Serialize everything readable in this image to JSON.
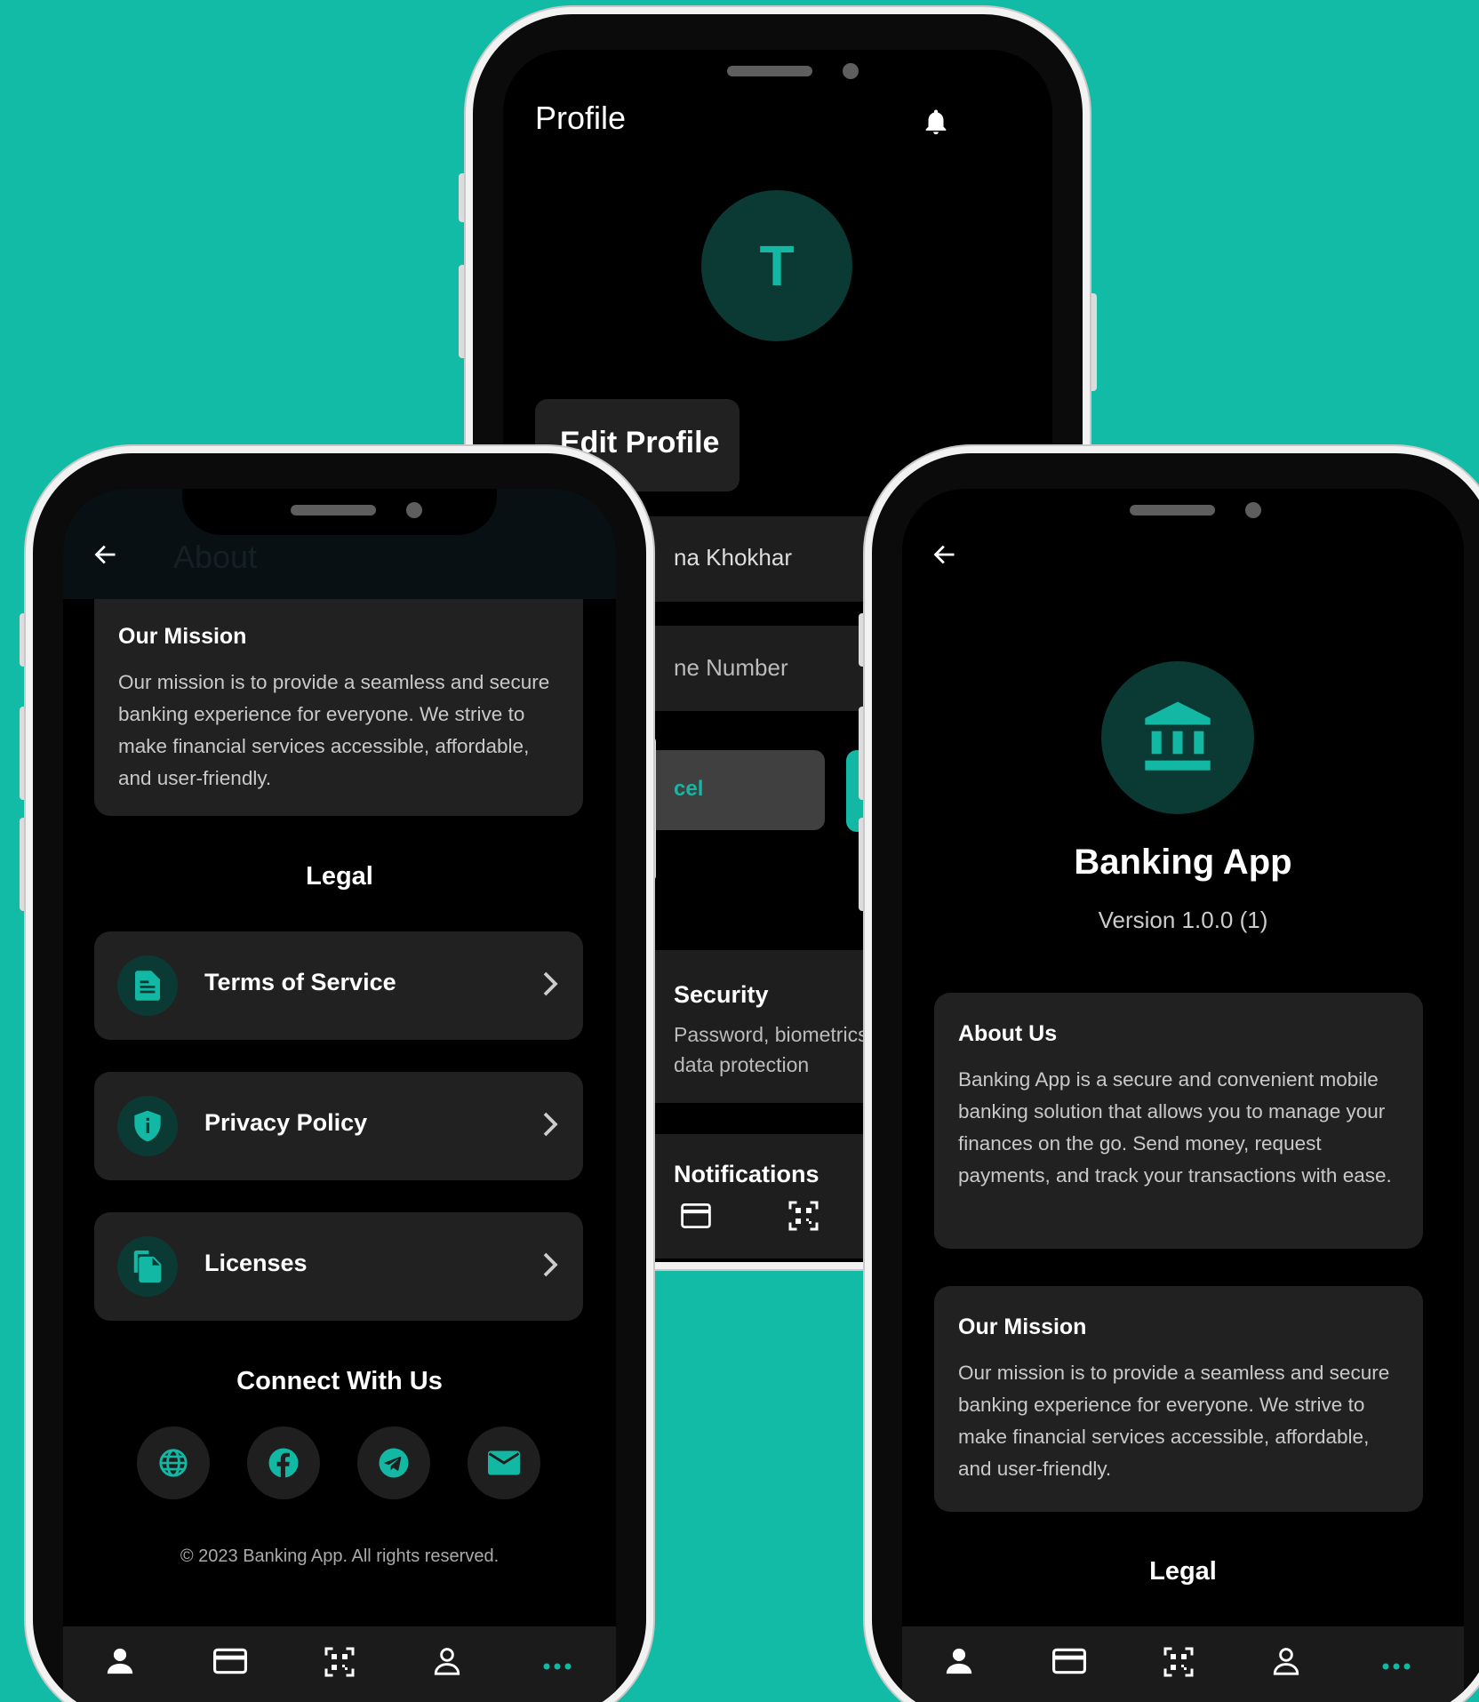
{
  "profile_phone": {
    "title": "Profile",
    "avatar_letter": "T",
    "edit_profile_label": "Edit Profile",
    "name_value": "na Khokhar",
    "phone_placeholder": "ne Number",
    "cancel_label": "cel",
    "security_title": "Security",
    "security_desc_1": "Password, biometrics,",
    "security_desc_2": "data protection",
    "notifications_title": "Notifications"
  },
  "about_left": {
    "header_title": "About",
    "mission": {
      "title": "Our Mission",
      "text": "Our mission is to provide a seamless and secure banking experience for everyone. We strive to make financial services accessible, affordable, and user-friendly."
    },
    "legal_heading": "Legal",
    "legal_items": [
      {
        "label": "Terms of Service",
        "icon": "document-icon"
      },
      {
        "label": "Privacy Policy",
        "icon": "shield-icon"
      },
      {
        "label": "Licenses",
        "icon": "copy-icon"
      }
    ],
    "connect_heading": "Connect With Us",
    "socials": [
      "globe-icon",
      "facebook-icon",
      "telegram-icon",
      "mail-icon"
    ],
    "copyright": "© 2023 Banking App. All rights reserved."
  },
  "about_right": {
    "app_name": "Banking App",
    "version": "Version 1.0.0 (1)",
    "about_us": {
      "title": "About Us",
      "text": "Banking App is a secure and convenient mobile banking solution that allows you to manage your finances on the go. Send money, request payments, and track your transactions with ease."
    },
    "mission": {
      "title": "Our Mission",
      "text": "Our mission is to provide a seamless and secure banking experience for everyone. We strive to make financial services accessible, affordable, and user-friendly."
    },
    "legal_heading": "Legal"
  },
  "nav_items": [
    "person-icon",
    "card-icon",
    "qr-icon",
    "profile-outline-icon",
    "more-icon"
  ],
  "colors": {
    "background": "#12bba6",
    "accent": "#13b8a4",
    "card": "#212121",
    "icon_circle": "#0b3a34"
  }
}
